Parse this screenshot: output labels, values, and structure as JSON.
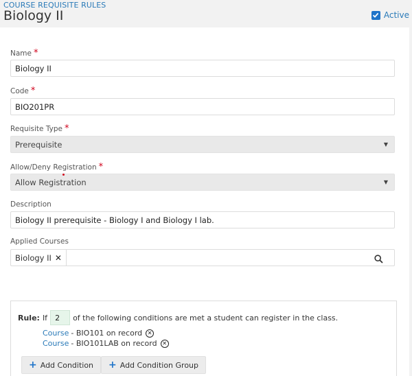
{
  "header": {
    "breadcrumb": "COURSE REQUISITE RULES",
    "title": "Biology II",
    "active_label": "Active",
    "active_checked": true
  },
  "form": {
    "name": {
      "label": "Name",
      "value": "Biology II"
    },
    "code": {
      "label": "Code",
      "value": "BIO201PR"
    },
    "requisite_type": {
      "label": "Requisite Type",
      "value": "Prerequisite"
    },
    "allow_deny": {
      "label": "Allow/Deny Registration",
      "value": "Allow Registration"
    },
    "description": {
      "label": "Description",
      "value": "Biology II prerequisite - Biology I and Biology I lab."
    },
    "applied_courses": {
      "label": "Applied Courses",
      "tags": [
        "Biology II"
      ]
    }
  },
  "rule": {
    "label": "Rule:",
    "if_text": "If",
    "count": "2",
    "suffix": "of the following conditions are met a student can register in the class.",
    "conditions": [
      {
        "type": "Course",
        "text": "- BIO101 on record"
      },
      {
        "type": "Course",
        "text": "- BIO101LAB on record"
      }
    ],
    "add_condition_label": "Add Condition",
    "add_group_label": "Add Condition Group"
  },
  "colors": {
    "accent": "#1e73c9",
    "link": "#2a7ab8",
    "required": "#d0021b"
  }
}
